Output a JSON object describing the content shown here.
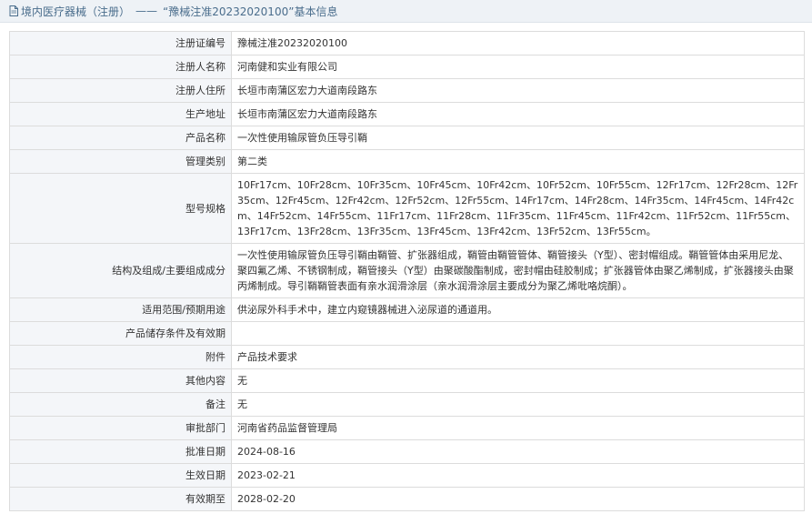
{
  "header": {
    "title": "境内医疗器械（注册）",
    "separator": "——",
    "reg_ref": "“豫械注准20232020100”",
    "suffix": "基本信息"
  },
  "rows": [
    {
      "label": "注册证编号",
      "value": "豫械注准20232020100"
    },
    {
      "label": "注册人名称",
      "value": "河南健和实业有限公司"
    },
    {
      "label": "注册人住所",
      "value": "长垣市南蒲区宏力大道南段路东"
    },
    {
      "label": "生产地址",
      "value": "长垣市南蒲区宏力大道南段路东"
    },
    {
      "label": "产品名称",
      "value": "一次性使用输尿管负压导引鞘"
    },
    {
      "label": "管理类别",
      "value": "第二类"
    },
    {
      "label": "型号规格",
      "value": "10Fr17cm、10Fr28cm、10Fr35cm、10Fr45cm、10Fr42cm、10Fr52cm、10Fr55cm、12Fr17cm、12Fr28cm、12Fr35cm、12Fr45cm、12Fr42cm、12Fr52cm、12Fr55cm、14Fr17cm、14Fr28cm、14Fr35cm、14Fr45cm、14Fr42cm、14Fr52cm、14Fr55cm、11Fr17cm、11Fr28cm、11Fr35cm、11Fr45cm、11Fr42cm、11Fr52cm、11Fr55cm、13Fr17cm、13Fr28cm、13Fr35cm、13Fr45cm、13Fr42cm、13Fr52cm、13Fr55cm。"
    },
    {
      "label": "结构及组成/主要组成成分",
      "value": "一次性使用输尿管负压导引鞘由鞘管、扩张器组成，鞘管由鞘管管体、鞘管接头（Y型）、密封帽组成。鞘管管体由采用尼龙、聚四氟乙烯、不锈钢制成，鞘管接头（Y型）由聚碳酸酯制成，密封帽由硅胶制成；扩张器管体由聚乙烯制成，扩张器接头由聚丙烯制成。导引鞘鞘管表面有亲水润滑涂层（亲水润滑涂层主要成分为聚乙烯吡咯烷酮）。"
    },
    {
      "label": "适用范围/预期用途",
      "value": "供泌尿外科手术中，建立内窥镜器械进入泌尿道的通道用。"
    },
    {
      "label": "产品储存条件及有效期",
      "value": ""
    },
    {
      "label": "附件",
      "value": "产品技术要求"
    },
    {
      "label": "其他内容",
      "value": "无"
    },
    {
      "label": "备注",
      "value": "无"
    },
    {
      "label": "审批部门",
      "value": "河南省药品监督管理局"
    },
    {
      "label": "批准日期",
      "value": "2024-08-16"
    },
    {
      "label": "生效日期",
      "value": "2023-02-21"
    },
    {
      "label": "有效期至",
      "value": "2028-02-20"
    }
  ]
}
